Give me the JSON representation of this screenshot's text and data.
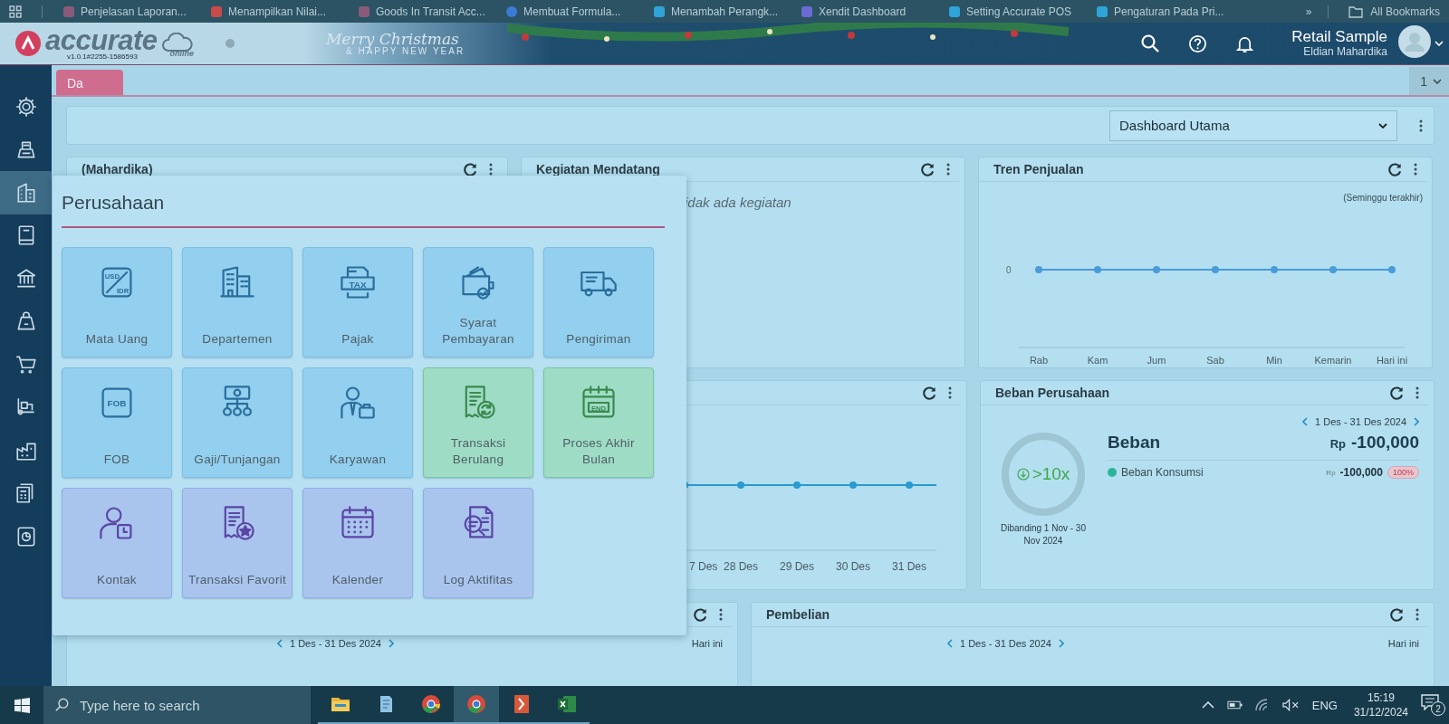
{
  "bookmarks_bar": {
    "items": [
      {
        "label": "Penjelasan Laporan..."
      },
      {
        "label": "Menampilkan Nilai..."
      },
      {
        "label": "Goods In Transit Acc..."
      },
      {
        "label": "Membuat Formula..."
      },
      {
        "label": "Menambah Perangk..."
      },
      {
        "label": "Xendit Dashboard"
      },
      {
        "label": "Setting Accurate POS"
      },
      {
        "label": "Pengaturan Pada Pri..."
      }
    ],
    "overflow": "»",
    "all_bookmarks": "All Bookmarks"
  },
  "header": {
    "logo": "accurate",
    "logo_sub": "online",
    "version": "v1.0.1#2255-1586593",
    "banner_title": "Merry Christmas",
    "banner_sub": "& HAPPY NEW YEAR",
    "company": "Retail Sample",
    "user": "Eldian Mahardika"
  },
  "sidebar": {
    "items": [
      {
        "selected": false
      },
      {
        "selected": false
      },
      {
        "selected": true
      },
      {
        "selected": false
      },
      {
        "selected": false
      },
      {
        "selected": false
      },
      {
        "selected": false
      },
      {
        "selected": false
      },
      {
        "selected": false
      },
      {
        "selected": false
      },
      {
        "selected": false
      }
    ]
  },
  "tab_bar": {
    "tabs": [
      {
        "label": "Da",
        "selected": true
      }
    ],
    "counter": "1"
  },
  "dashboard_select": {
    "value": "Dashboard Utama"
  },
  "panels": [
    {
      "kind": "info",
      "title": "(Mahardika)"
    },
    {
      "kind": "events",
      "title": "Kegiatan Mendatang",
      "message": "idak ada kegiatan"
    },
    {
      "kind": "trend",
      "title": "Tren Penjualan",
      "note": "(Seminggu terakhir)",
      "y_label": "0",
      "x_labels": [
        "Rab",
        "Kam",
        "Jum",
        "Sab",
        "Min",
        "Kemarin",
        "Hari ini"
      ]
    },
    {
      "kind": "daily",
      "x_labels": [
        "7 Des",
        "28 Des",
        "29 Des",
        "30 Des",
        "31 Des"
      ]
    },
    {
      "kind": "expense",
      "title": "Beban Perusahaan",
      "range": "1 Des - 31 Des 2024",
      "ratio": ">10x",
      "compare": "Dibanding 1 Nov - 30 Nov 2024",
      "heading": "Beban",
      "currency": "Rp",
      "total": "-100,000",
      "items": [
        {
          "label": "Beban Konsumsi",
          "color": "#2bb59c",
          "currency": "Rp",
          "amount": "-100,000",
          "share": "100%"
        }
      ]
    },
    {
      "kind": "summary",
      "range": "1 Des - 31 Des 2024",
      "period": "Hari ini"
    },
    {
      "kind": "summary",
      "title": "Pembelian",
      "range": "1 Des - 31 Des 2024",
      "period": "Hari ini"
    }
  ],
  "popup": {
    "title": "Perusahaan",
    "tiles": [
      {
        "label": "Mata Uang",
        "kind": "master",
        "icon_text": [
          "USD",
          "IDR"
        ]
      },
      {
        "label": "Departemen",
        "kind": "master"
      },
      {
        "label": "Pajak",
        "kind": "master",
        "icon_text": [
          "TAX"
        ]
      },
      {
        "label": "Syarat Pembayaran",
        "kind": "master"
      },
      {
        "label": "Pengiriman",
        "kind": "master"
      },
      {
        "label": "FOB",
        "kind": "master",
        "icon_text": [
          "FOB"
        ]
      },
      {
        "label": "Gaji/Tunjangan",
        "kind": "master"
      },
      {
        "label": "Karyawan",
        "kind": "master"
      },
      {
        "label": "Transaksi Berulang",
        "kind": "process"
      },
      {
        "label": "Proses Akhir Bulan",
        "kind": "process",
        "icon_text": [
          "END"
        ]
      },
      {
        "label": "Kontak",
        "kind": "tool"
      },
      {
        "label": "Transaksi Favorit",
        "kind": "tool"
      },
      {
        "label": "Kalender",
        "kind": "tool"
      },
      {
        "label": "Log Aktifitas",
        "kind": "tool"
      }
    ]
  },
  "taskbar": {
    "search_placeholder": "Type here to search",
    "apps": [
      {
        "selected": false
      },
      {
        "selected": false
      },
      {
        "selected": false
      },
      {
        "selected": true
      },
      {
        "selected": false
      },
      {
        "selected": false
      }
    ],
    "language": "ENG",
    "time": "15:19",
    "date": "31/12/2024",
    "notifications": "2"
  }
}
